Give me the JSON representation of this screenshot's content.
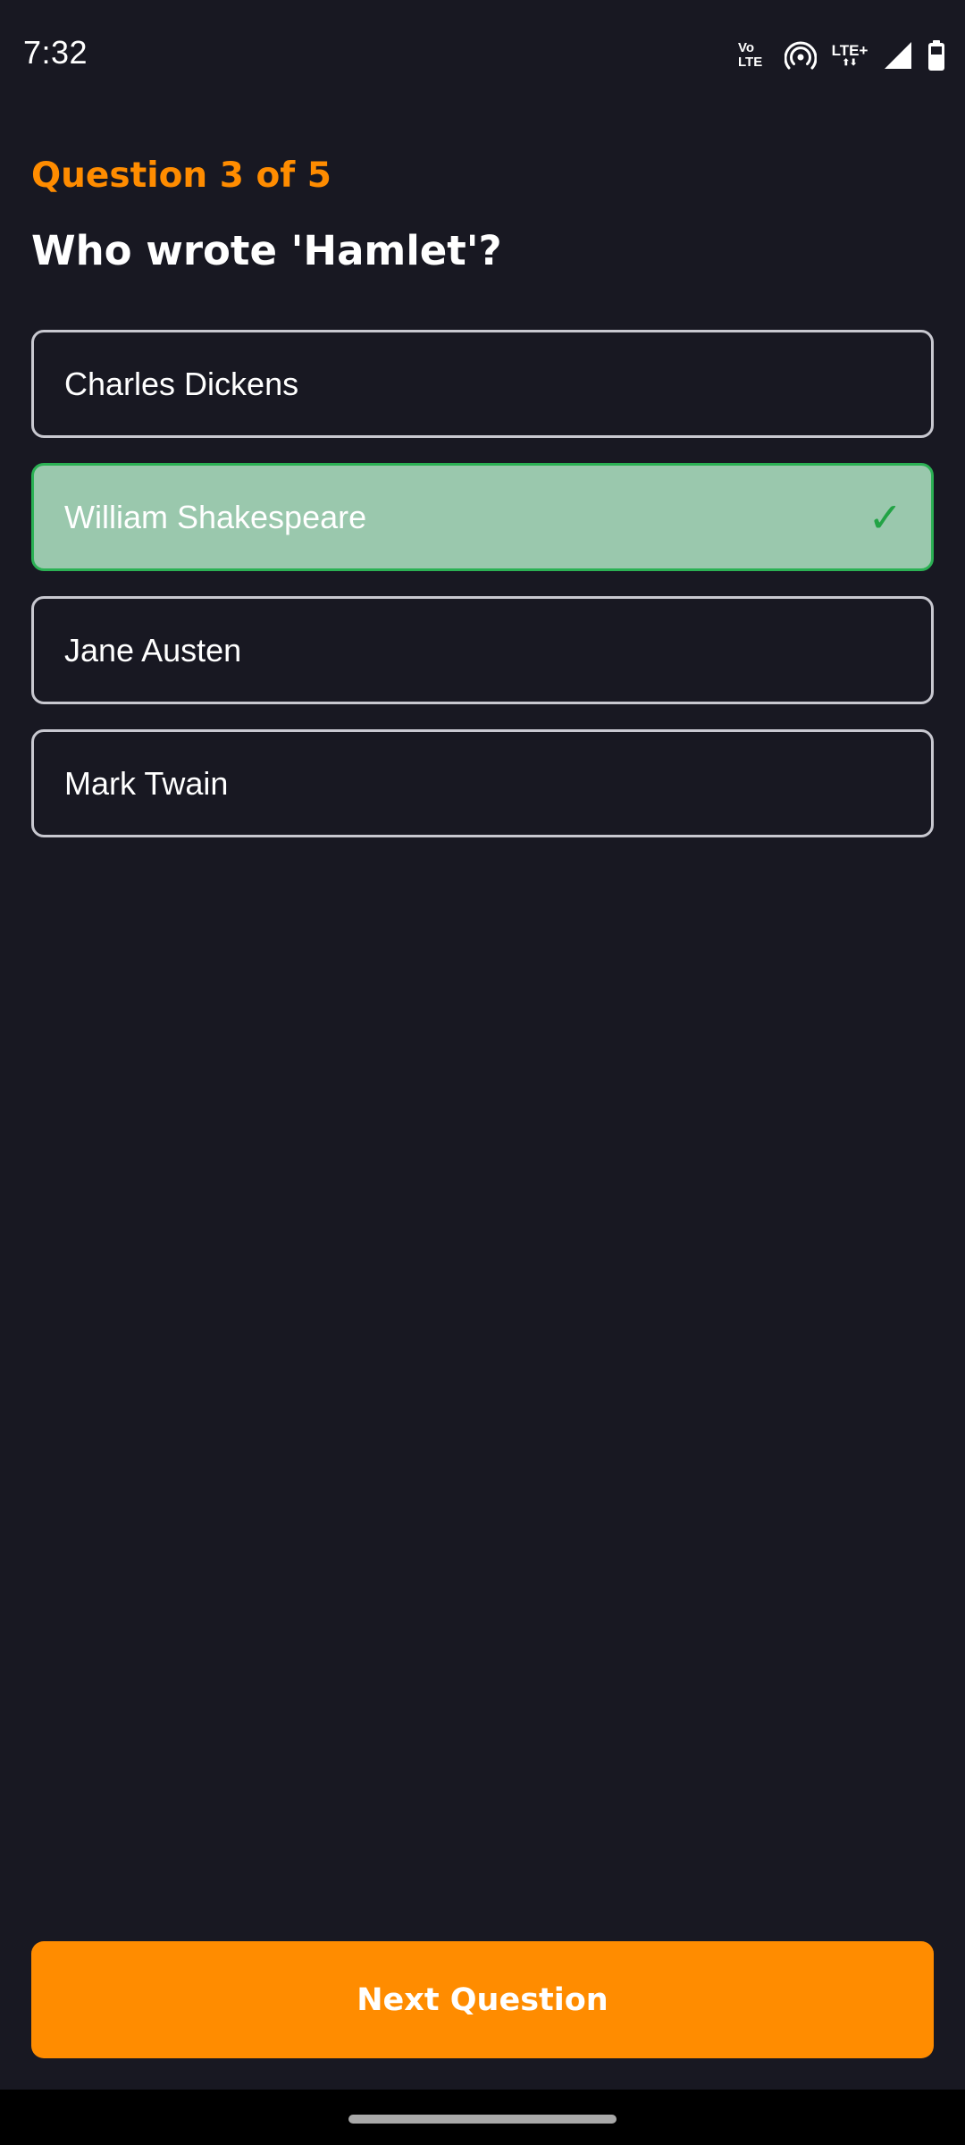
{
  "status_bar": {
    "time": "7:32",
    "volte_line1": "Vo",
    "volte_line2": "LTE",
    "lte_label": "LTE+",
    "lte_arrows": "⬆⬇",
    "icons": [
      "volte-icon",
      "hotspot-icon",
      "lte-plus-icon",
      "signal-icon",
      "battery-icon"
    ]
  },
  "quiz": {
    "progress_label": "Question 3 of 5",
    "current_question": 3,
    "total_questions": 5,
    "question": "Who wrote 'Hamlet'?",
    "options": [
      {
        "label": "Charles Dickens",
        "state": "default"
      },
      {
        "label": "William Shakespeare",
        "state": "correct"
      },
      {
        "label": "Jane Austen",
        "state": "default"
      },
      {
        "label": "Mark Twain",
        "state": "default"
      }
    ],
    "correct_mark": "✓",
    "next_button_label": "Next Question"
  },
  "colors": {
    "background": "#181822",
    "accent": "#ff8c00",
    "correct_fill": "#9ac8ad",
    "correct_border": "#2bb154",
    "check": "#22a345",
    "option_border": "#c8c8d0"
  }
}
